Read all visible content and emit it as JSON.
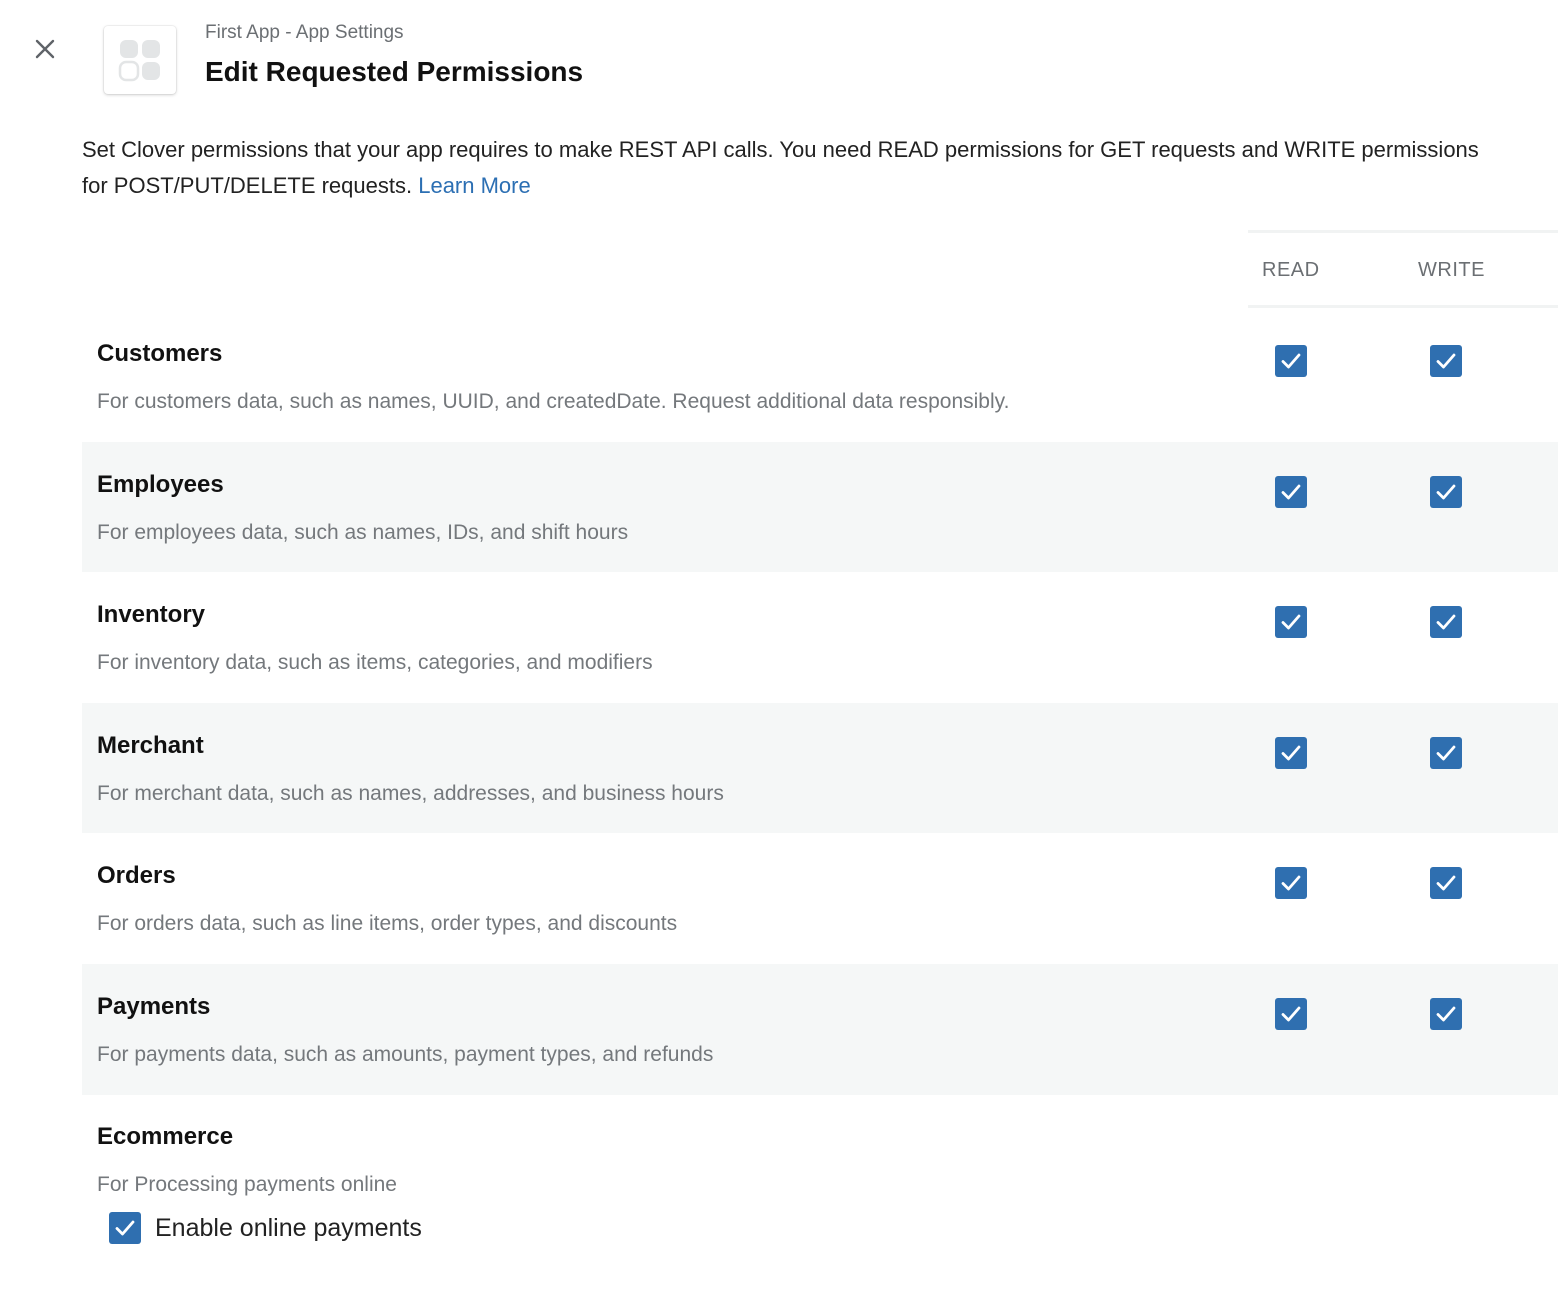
{
  "header": {
    "breadcrumb": "First App - App Settings",
    "title": "Edit Requested Permissions"
  },
  "intro": {
    "text": "Set Clover permissions that your app requires to make REST API calls. You need READ permissions for GET requests and WRITE permissions for POST/PUT/DELETE requests. ",
    "link_label": "Learn More"
  },
  "columns": {
    "read": "READ",
    "write": "WRITE"
  },
  "permissions": [
    {
      "name": "Customers",
      "description": "For customers data, such as names, UUID, and createdDate. Request additional data responsibly.",
      "read": true,
      "write": true
    },
    {
      "name": "Employees",
      "description": "For employees data, such as names, IDs, and shift hours",
      "read": true,
      "write": true
    },
    {
      "name": "Inventory",
      "description": "For inventory data, such as items, categories, and modifiers",
      "read": true,
      "write": true
    },
    {
      "name": "Merchant",
      "description": "For merchant data, such as names, addresses, and business hours",
      "read": true,
      "write": true
    },
    {
      "name": "Orders",
      "description": "For orders data, such as line items, order types, and discounts",
      "read": true,
      "write": true
    },
    {
      "name": "Payments",
      "description": "For payments data, such as amounts, payment types, and refunds",
      "read": true,
      "write": true
    }
  ],
  "ecommerce": {
    "name": "Ecommerce",
    "description": "For Processing payments online",
    "enable_label": "Enable online payments",
    "enabled": true
  },
  "icons": {
    "close": "close-icon",
    "app": "clover-logo-icon",
    "check": "checkmark-icon"
  },
  "colors": {
    "accent": "#2f6fb0",
    "link": "#2c6fb3",
    "row_shade": "#f5f7f7"
  }
}
